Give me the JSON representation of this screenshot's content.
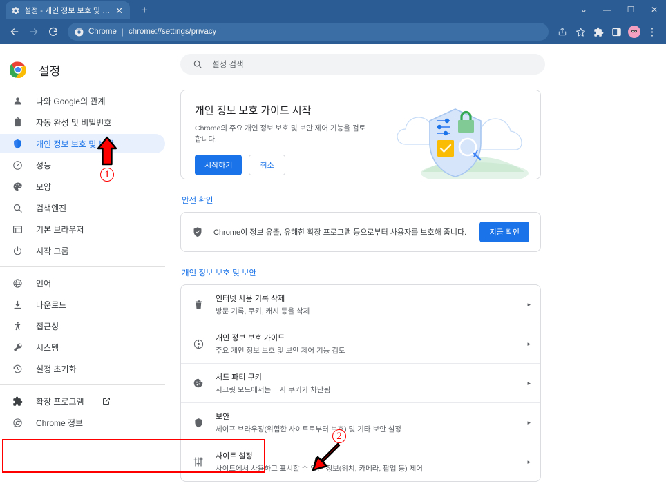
{
  "window": {
    "tab_title": "설정 - 개인 정보 보호 및 보안",
    "tab_close": "✕",
    "new_tab": "+",
    "controls": {
      "expand": "⌄",
      "minimize": "—",
      "maximize": "☐",
      "close": "✕"
    }
  },
  "toolbar": {
    "back": "←",
    "forward": "→",
    "reload": "⟳",
    "chrome_label": "Chrome",
    "separator": "|",
    "url": "chrome://settings/privacy",
    "share_icon": "share-icon",
    "bookmark_icon": "star-icon",
    "extensions_icon": "puzzle-icon",
    "sidepanel_icon": "side-panel-icon",
    "profile_icon": "avatar",
    "menu_icon": "⋮"
  },
  "sidebar": {
    "brand": "설정",
    "items": [
      {
        "label": "나와 Google의 관계",
        "icon": "person-icon",
        "active": false
      },
      {
        "label": "자동 완성 및 비밀번호",
        "icon": "clipboard-icon",
        "active": false
      },
      {
        "label": "개인 정보 보호 및 보안",
        "icon": "shield-icon",
        "active": true
      },
      {
        "label": "성능",
        "icon": "speedometer-icon",
        "active": false
      },
      {
        "label": "모양",
        "icon": "palette-icon",
        "active": false
      },
      {
        "label": "검색엔진",
        "icon": "search-icon",
        "active": false
      },
      {
        "label": "기본 브라우저",
        "icon": "browser-window-icon",
        "active": false
      },
      {
        "label": "시작 그룹",
        "icon": "power-icon",
        "active": false
      }
    ],
    "items2": [
      {
        "label": "언어",
        "icon": "globe-icon"
      },
      {
        "label": "다운로드",
        "icon": "download-icon"
      },
      {
        "label": "접근성",
        "icon": "accessibility-icon"
      },
      {
        "label": "시스템",
        "icon": "wrench-icon"
      },
      {
        "label": "설정 초기화",
        "icon": "restore-icon"
      }
    ],
    "items3": [
      {
        "label": "확장 프로그램",
        "icon": "extension-puzzle-icon",
        "external": true
      },
      {
        "label": "Chrome 정보",
        "icon": "chrome-icon",
        "external": false
      }
    ]
  },
  "search": {
    "placeholder": "설정 검색",
    "icon": "search-icon"
  },
  "guide_card": {
    "title": "개인 정보 보호 가이드 시작",
    "description": "Chrome의 주요 개인 정보 보호 및 보안 제어 기능을 검토합니다.",
    "primary_button": "시작하기",
    "secondary_button": "취소",
    "illustration": "privacy-shield-illustration"
  },
  "safety_check": {
    "section_title": "안전 확인",
    "icon": "shield-check-icon",
    "message": "Chrome이 정보 유출, 유해한 확장 프로그램 등으로부터 사용자를 보호해 줍니다.",
    "button": "지금 확인"
  },
  "privacy_section": {
    "section_title": "개인 정보 보호 및 보안",
    "rows": [
      {
        "icon": "trash-icon",
        "title": "인터넷 사용 기록 삭제",
        "subtitle": "방문 기록, 쿠키, 캐시 등을 삭제",
        "arrow": "▸",
        "highlighted": false
      },
      {
        "icon": "privacy-guide-icon",
        "title": "개인 정보 보호 가이드",
        "subtitle": "주요 개인 정보 보호 및 보안 제어 기능 검토",
        "arrow": "▸",
        "highlighted": false
      },
      {
        "icon": "cookie-icon",
        "title": "서드 파티 쿠키",
        "subtitle": "시크릿 모드에서는 타사 쿠키가 차단됨",
        "arrow": "▸",
        "highlighted": false
      },
      {
        "icon": "security-shield-icon",
        "title": "보안",
        "subtitle": "세이프 브라우징(위험한 사이트로부터 보호) 및 기타 보안 설정",
        "arrow": "▸",
        "highlighted": false
      },
      {
        "icon": "sliders-icon",
        "title": "사이트 설정",
        "subtitle": "사이트에서 사용하고 표시할 수 있는 정보(위치, 카메라, 팝업 등) 제어",
        "arrow": "▸",
        "highlighted": true
      }
    ]
  },
  "annotations": {
    "marker1": "1",
    "marker2": "2",
    "highlight_color": "#ff0000"
  }
}
